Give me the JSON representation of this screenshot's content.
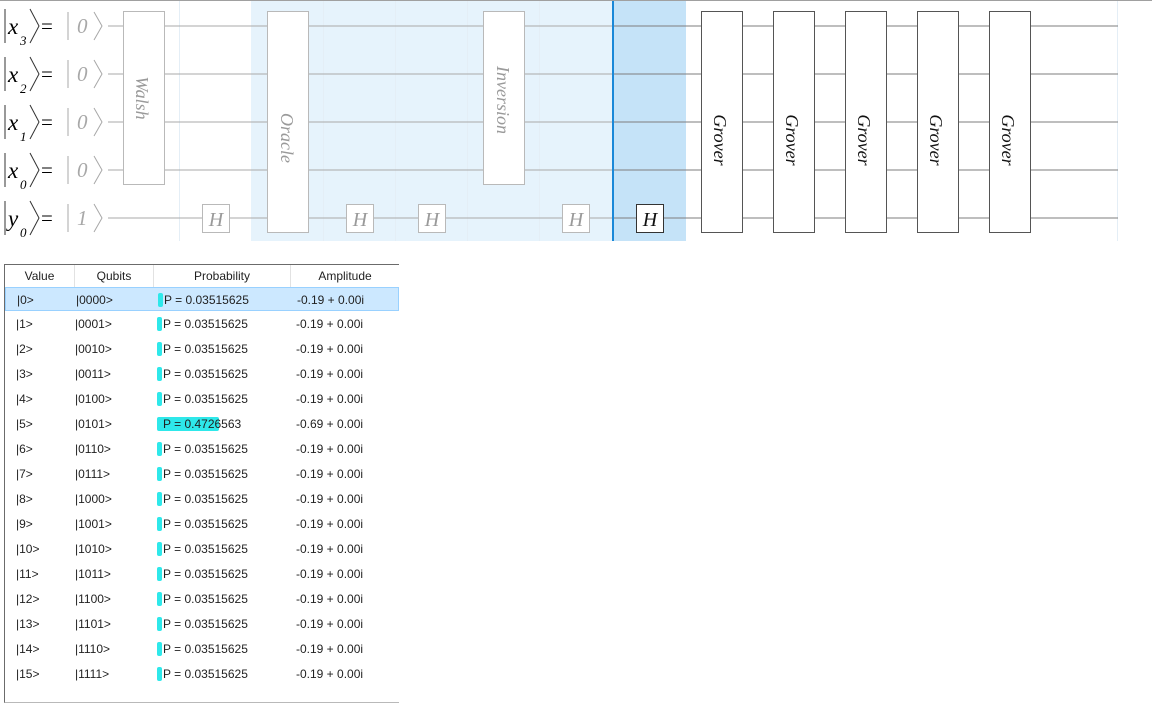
{
  "circuit": {
    "wires": [
      {
        "prefix": "x",
        "sub": "3",
        "eq": "=",
        "init": "0"
      },
      {
        "prefix": "x",
        "sub": "2",
        "eq": "=",
        "init": "0"
      },
      {
        "prefix": "x",
        "sub": "1",
        "eq": "=",
        "init": "0"
      },
      {
        "prefix": "x",
        "sub": "0",
        "eq": "=",
        "init": "0"
      },
      {
        "prefix": "y",
        "sub": "0",
        "eq": "=",
        "init": "1"
      }
    ],
    "gates": {
      "walsh": "Walsh",
      "oracle": "Oracle",
      "inversion": "Inversion",
      "h": "H",
      "grover": "Grover"
    },
    "grover_count": 5
  },
  "table": {
    "columns": {
      "value": "Value",
      "qubits": "Qubits",
      "probability": "Probability",
      "amplitude": "Amplitude"
    },
    "selected_index": 0,
    "rows": [
      {
        "value": "|0>",
        "qubits": "|0000>",
        "probability": "P = 0.03515625",
        "p": 0.03515625,
        "amplitude": "-0.19 + 0.00i"
      },
      {
        "value": "|1>",
        "qubits": "|0001>",
        "probability": "P = 0.03515625",
        "p": 0.03515625,
        "amplitude": "-0.19 + 0.00i"
      },
      {
        "value": "|2>",
        "qubits": "|0010>",
        "probability": "P = 0.03515625",
        "p": 0.03515625,
        "amplitude": "-0.19 + 0.00i"
      },
      {
        "value": "|3>",
        "qubits": "|0011>",
        "probability": "P = 0.03515625",
        "p": 0.03515625,
        "amplitude": "-0.19 + 0.00i"
      },
      {
        "value": "|4>",
        "qubits": "|0100>",
        "probability": "P = 0.03515625",
        "p": 0.03515625,
        "amplitude": "-0.19 + 0.00i"
      },
      {
        "value": "|5>",
        "qubits": "|0101>",
        "probability": "P = 0.4726563",
        "p": 0.4726563,
        "amplitude": "-0.69 + 0.00i"
      },
      {
        "value": "|6>",
        "qubits": "|0110>",
        "probability": "P = 0.03515625",
        "p": 0.03515625,
        "amplitude": "-0.19 + 0.00i"
      },
      {
        "value": "|7>",
        "qubits": "|0111>",
        "probability": "P = 0.03515625",
        "p": 0.03515625,
        "amplitude": "-0.19 + 0.00i"
      },
      {
        "value": "|8>",
        "qubits": "|1000>",
        "probability": "P = 0.03515625",
        "p": 0.03515625,
        "amplitude": "-0.19 + 0.00i"
      },
      {
        "value": "|9>",
        "qubits": "|1001>",
        "probability": "P = 0.03515625",
        "p": 0.03515625,
        "amplitude": "-0.19 + 0.00i"
      },
      {
        "value": "|10>",
        "qubits": "|1010>",
        "probability": "P = 0.03515625",
        "p": 0.03515625,
        "amplitude": "-0.19 + 0.00i"
      },
      {
        "value": "|11>",
        "qubits": "|1011>",
        "probability": "P = 0.03515625",
        "p": 0.03515625,
        "amplitude": "-0.19 + 0.00i"
      },
      {
        "value": "|12>",
        "qubits": "|1100>",
        "probability": "P = 0.03515625",
        "p": 0.03515625,
        "amplitude": "-0.19 + 0.00i"
      },
      {
        "value": "|13>",
        "qubits": "|1101>",
        "probability": "P = 0.03515625",
        "p": 0.03515625,
        "amplitude": "-0.19 + 0.00i"
      },
      {
        "value": "|14>",
        "qubits": "|1110>",
        "probability": "P = 0.03515625",
        "p": 0.03515625,
        "amplitude": "-0.19 + 0.00i"
      },
      {
        "value": "|15>",
        "qubits": "|1111>",
        "probability": "P = 0.03515625",
        "p": 0.03515625,
        "amplitude": "-0.19 + 0.00i"
      }
    ]
  },
  "colors": {
    "wire": "#a9a9a9",
    "gate_border": "#7a7a7a",
    "step_shade": "#e6f3fc",
    "current_shade": "#c5e3f8",
    "cursor": "#1a88d8",
    "prob_bar": "#2ee8ea",
    "selected_row": "#cce8ff"
  }
}
